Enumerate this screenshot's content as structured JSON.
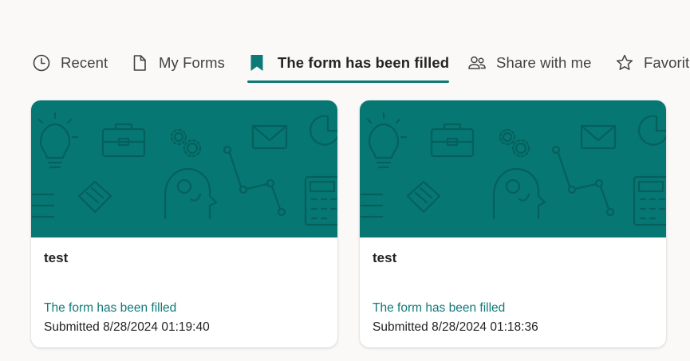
{
  "theme": {
    "accent": "#0e7a77",
    "banner_color": "#077773",
    "banner_pattern_color": "#05605d",
    "background": "#faf9f8"
  },
  "tabs": [
    {
      "label": "Recent",
      "icon": "clock-icon",
      "active": false
    },
    {
      "label": "My Forms",
      "icon": "document-icon",
      "active": false
    },
    {
      "label": "The form has been filled",
      "icon": "bookmark-icon",
      "active": true
    },
    {
      "label": "Share with me",
      "icon": "people-icon",
      "active": false
    },
    {
      "label": "Favorites",
      "icon": "star-icon",
      "active": false
    }
  ],
  "cards": [
    {
      "title": "test",
      "status": "The form has been filled",
      "submitted": "Submitted 8/28/2024 01:19:40"
    },
    {
      "title": "test",
      "status": "The form has been filled",
      "submitted": "Submitted 8/28/2024 01:18:36"
    }
  ]
}
